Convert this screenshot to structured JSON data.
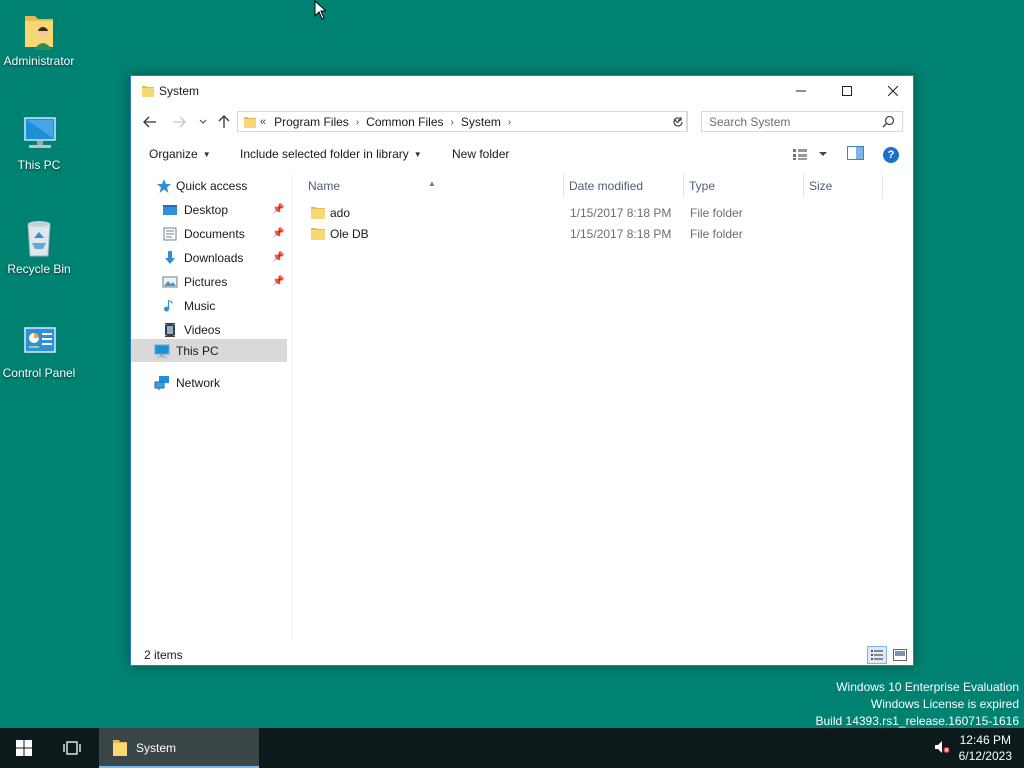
{
  "desktop": {
    "icons": [
      {
        "label": "Administrator",
        "icon": "user-folder-icon"
      },
      {
        "label": "This PC",
        "icon": "computer-icon"
      },
      {
        "label": "Recycle Bin",
        "icon": "recycle-bin-icon"
      },
      {
        "label": "Control Panel",
        "icon": "control-panel-icon"
      }
    ],
    "watermark": {
      "line1": "Windows 10 Enterprise Evaluation",
      "line2": "Windows License is expired",
      "line3": "Build 14393.rs1_release.160715-1616"
    }
  },
  "window": {
    "title": "System",
    "address": {
      "overflow": "«",
      "crumbs": [
        "Program Files",
        "Common Files",
        "System"
      ]
    },
    "search": {
      "placeholder": "Search System"
    },
    "commands": {
      "organize": "Organize",
      "include": "Include selected folder in library",
      "new_folder": "New folder"
    },
    "nav": {
      "quick_access": "Quick access",
      "items": [
        {
          "label": "Desktop",
          "pinned": true
        },
        {
          "label": "Documents",
          "pinned": true
        },
        {
          "label": "Downloads",
          "pinned": true
        },
        {
          "label": "Pictures",
          "pinned": true
        },
        {
          "label": "Music",
          "pinned": false
        },
        {
          "label": "Videos",
          "pinned": false
        }
      ],
      "this_pc": "This PC",
      "network": "Network"
    },
    "columns": {
      "name": "Name",
      "date": "Date modified",
      "type": "Type",
      "size": "Size"
    },
    "files": [
      {
        "name": "ado",
        "date": "1/15/2017 8:18 PM",
        "type": "File folder",
        "size": ""
      },
      {
        "name": "Ole DB",
        "date": "1/15/2017 8:18 PM",
        "type": "File folder",
        "size": ""
      }
    ],
    "status": {
      "count": "2 items"
    }
  },
  "taskbar": {
    "app_label": "System",
    "time": "12:46 PM",
    "date": "6/12/2023"
  },
  "colors": {
    "desktop": "#008272",
    "taskbar": "#0c1a1c",
    "accent": "#2b79d0",
    "folder": "#f8d775"
  }
}
